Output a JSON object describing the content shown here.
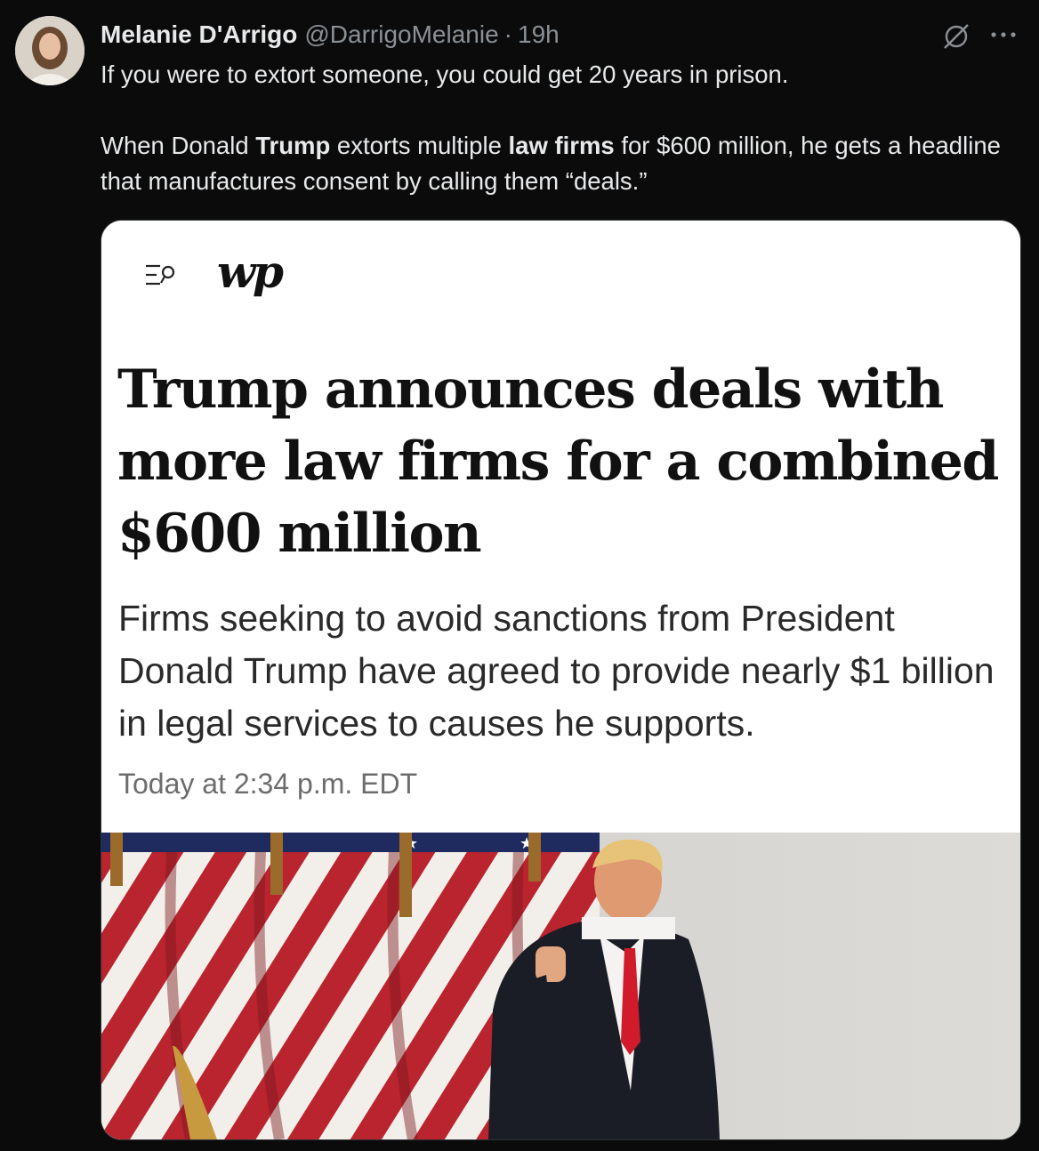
{
  "post": {
    "author": {
      "name": "Melanie D'Arrigo",
      "handle": "@DarrigoMelanie",
      "separator": "·",
      "time": "19h"
    },
    "text_line1": "If you were to extort someone, you could get 20 years in prison.",
    "text_para2": {
      "p1": "When Donald ",
      "b1": "Trump",
      "p2": " extorts multiple ",
      "b2": "law firms",
      "p3": " for $600 million, he gets a headline that manufactures consent by calling them “deals.”"
    },
    "icons": {
      "grok": "grok-icon",
      "more": "more-icon"
    }
  },
  "article_image": {
    "logo": "wp",
    "headline": "Trump announces deals with more law firms for a combined $600 million",
    "dek": "Firms seeking to avoid sanctions from President Donald Trump have agreed to provide nearly $1 billion in legal services to causes he supports.",
    "timestamp": "Today at 2:34 p.m. EDT"
  },
  "colors": {
    "background": "#0b0b0c",
    "text": "#e7e9ea",
    "muted": "#8b9095",
    "flag_red": "#b9242f",
    "tie_red": "#d11b2a"
  }
}
